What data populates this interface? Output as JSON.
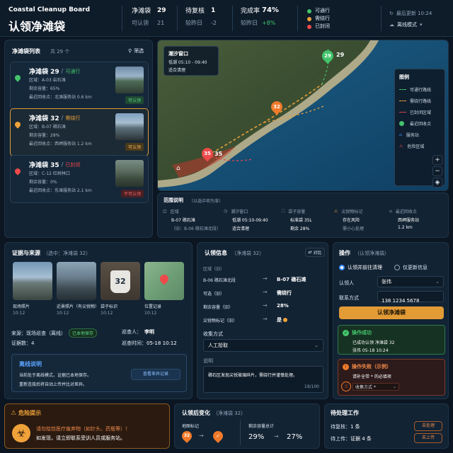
{
  "header": {
    "brand": "Coastal Cleanup Board",
    "title": "认领净滩袋",
    "stats": [
      {
        "label": "净滩袋",
        "value": "29",
        "sub_label": "可认领",
        "sub_value": "21"
      },
      {
        "label": "待复核",
        "value": "1",
        "sub_label": "较昨日",
        "sub_value": "-2"
      },
      {
        "label": "完成率",
        "value": "74%",
        "sub_label": "较昨日",
        "sub_value": "+8%"
      }
    ],
    "status_legend": [
      "可通行",
      "需绕行",
      "已封闭"
    ],
    "last_update": "最后更新 10:24",
    "mode": "离线模式"
  },
  "list": {
    "title": "净滩袋列表",
    "count": "共 29 个",
    "filter": "筛选",
    "items": [
      {
        "name": "净滩袋 29",
        "sep": "/",
        "status": "可通行",
        "area": "区域：A-03 岩石滩",
        "capacity": "剩余容量：65%",
        "station": "最近回收点：北滩服务站 0.6 km",
        "tag": "可认领",
        "status_color": "#43c46b"
      },
      {
        "name": "净滩袋 32",
        "sep": "/",
        "status": "需绕行",
        "area": "区域：B-07 礁石滩",
        "capacity": "剩余容量：28%",
        "station": "最近回收点：西岬服务站 1.2 km",
        "tag": "可认领",
        "status_color": "#f0a23a"
      },
      {
        "name": "净滩袋 35",
        "sep": "/",
        "status": "已封闭",
        "area": "区域：C-12 红树林口",
        "capacity": "剩余容量：0%",
        "station": "最近回收点：东滩服务站 2.1 km",
        "tag": "不可认领",
        "status_color": "#ee4a4a"
      }
    ]
  },
  "map": {
    "tide_title": "潮汐窗口",
    "tide_time": "低潮 05:10 - 09:40",
    "tide_note": "适合清理",
    "pins": [
      {
        "label": "29",
        "color": "#43c46b"
      },
      {
        "label": "32",
        "color": "#f07a2a"
      },
      {
        "label": "35",
        "color": "#ee4a4a"
      }
    ],
    "legend_title": "图例",
    "legend": [
      "可通行路线",
      "需绕行路线",
      "已封闭区域",
      "最近回收点",
      "服务站",
      "危险区域"
    ]
  },
  "range": {
    "title": "范围说明",
    "subtitle": "（以选中项为准）",
    "cells": [
      {
        "k": "区域",
        "v": "B-07 礁石滩",
        "v2": "（旧：B-06 礁石滩北段）"
      },
      {
        "k": "潮汐窗口",
        "v": "低潮 05:10-09:40",
        "v2": "适合清理"
      },
      {
        "k": "袋子容量",
        "v": "标准袋 35L",
        "v2": "剩余 28%"
      },
      {
        "k": "尖锐物标记",
        "v": "存在风险",
        "v2": "需小心处理"
      },
      {
        "k": "最近回收点",
        "v": "西岬服务站",
        "v2": "1.2 km"
      }
    ]
  },
  "evidence": {
    "title": "证据与来源",
    "subtitle": "（选中：净滩袋 32）",
    "photos": [
      {
        "label": "现场照片",
        "time": "10:12"
      },
      {
        "label": "近景照片（有尖锐物）",
        "time": "10:12"
      },
      {
        "label": "袋子标识",
        "time": "10:12",
        "bag": "32"
      },
      {
        "label": "位置记录",
        "time": "10:12"
      }
    ],
    "source_label": "来源：现场巡查（离线）",
    "saved": "已本地保存",
    "inspector_label": "巡查人：",
    "inspector": "李明",
    "evidence_count": "证据数：4",
    "time_label": "巡查时间：",
    "time": "05-18 10:12",
    "offline_title": "离线说明",
    "offline_text1": "当前处于离线模式，证据已本地保存。",
    "offline_text2": "重新连接后将自动上传并比对差异。",
    "diff_button": "查看差异记录"
  },
  "claim": {
    "title": "认领信息",
    "subtitle": "（净滩袋 32）",
    "compare": "对比",
    "rows": [
      {
        "k": "区域（旧）",
        "old": "B-06 礁石滩北段",
        "new": "B-07 礁石滩"
      },
      {
        "k": "可选（旧）",
        "old": "可通行",
        "new": "需绕行"
      },
      {
        "k": "剩余容量（旧）",
        "old": "65%",
        "new": "28%"
      },
      {
        "k": "尖锐物标记（旧）",
        "old": "否",
        "new": "是"
      }
    ],
    "method_label": "收集方式",
    "method": "人工拾取",
    "note_label": "说明",
    "note": "礁石区发现尖锐玻璃碎片，需绕行并谨慎处理。",
    "note_count": "19/100"
  },
  "action": {
    "title": "操作",
    "subtitle": "（认领净滩袋）",
    "opt1": "认领并前往清理",
    "opt2": "仅更新信息",
    "claimer_label": "认领人",
    "claimer": "张伟",
    "phone_label": "联系方式",
    "phone": "138 1234 5678",
    "submit": "认领净滩袋",
    "success_title": "操作成功",
    "success_text": "已成功认领 净滩袋 32",
    "success_meta": "张伟  05-18 10:24",
    "fail_title": "操作失败（示例）",
    "fail_text": "请补全带 * 的必填项",
    "fail_sub": "收集方式 *"
  },
  "hazard": {
    "title": "危险提示",
    "text1": "请勿拾捡医疗废弃物（如针头、药瓶等）！",
    "text2": "如发现，请立即联系受训人员或服务站。"
  },
  "change": {
    "title": "认领后变化",
    "subtitle": "（净滩袋 32）",
    "map_label": "地图标记",
    "cap_label": "剩余容量总计",
    "before": "29%",
    "after": "27%",
    "pin": "32"
  },
  "pending": {
    "title": "待处理工作",
    "rows": [
      {
        "k": "待复核：",
        "v": "1 条",
        "btn": "去处理"
      },
      {
        "k": "待上传：",
        "v": "证据 4 条",
        "btn": "去上传"
      }
    ]
  }
}
